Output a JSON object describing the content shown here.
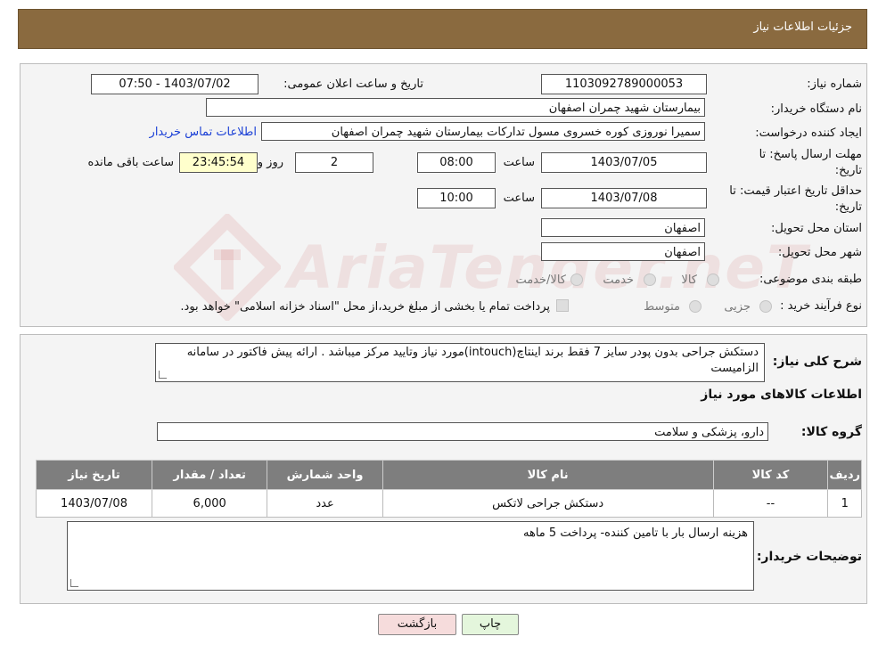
{
  "header": {
    "title": "جزئیات اطلاعات نیاز"
  },
  "form": {
    "need_number_label": "شماره نیاز:",
    "need_number": "1103092789000053",
    "announce_label": "تاریخ و ساعت اعلان عمومی:",
    "announce_value": "1403/07/02 - 07:50",
    "buyer_label": "نام دستگاه خریدار:",
    "buyer_value": "بیمارستان شهید چمران اصفهان",
    "creator_label": "ایجاد کننده درخواست:",
    "creator_value": "سمیرا نوروزی کوره خسروی مسول تدارکات بیمارستان شهید چمران اصفهان",
    "contact_link": "اطلاعات تماس خریدار",
    "reply_deadline_label_1": "مهلت ارسال پاسخ: تا",
    "reply_deadline_label_2": "تاریخ:",
    "reply_date": "1403/07/05",
    "time_label": "ساعت",
    "reply_time": "08:00",
    "days_value": "2",
    "days_label": "روز و",
    "remaining_time": "23:45:54",
    "remaining_label": "ساعت باقی مانده",
    "validity_label_1": "حداقل تاریخ اعتبار قیمت: تا",
    "validity_label_2": "تاریخ:",
    "validity_date": "1403/07/08",
    "validity_time": "10:00",
    "province_label": "استان محل تحویل:",
    "province_value": "اصفهان",
    "city_label": "شهر محل تحویل:",
    "city_value": "اصفهان",
    "category_label": "طبقه بندی موضوعی:",
    "category_options": [
      "کالا",
      "خدمت",
      "کالا/خدمت"
    ],
    "purchase_type_label": "نوع فرآیند خرید :",
    "purchase_options": [
      "جزیی",
      "متوسط"
    ],
    "purchase_note": "پرداخت تمام یا بخشی از مبلغ خرید،از محل \"اسناد خزانه اسلامی\" خواهد بود."
  },
  "details": {
    "summary_label": "شرح کلی نیاز:",
    "summary_text": "دستکش جراحی بدون پودر سایز 7 فقط برند اینتاچ(intouch)مورد نیاز وتایید مرکز میباشد . ارائه پیش فاکتور در سامانه الزامیست",
    "goods_info_title": "اطلاعات کالاهای مورد نیاز",
    "goods_group_label": "گروه کالا:",
    "goods_group_value": "دارو، پزشکی و سلامت",
    "table": {
      "headers": [
        "ردیف",
        "کد کالا",
        "نام کالا",
        "واحد شمارش",
        "تعداد / مقدار",
        "تاریخ نیاز"
      ],
      "rows": [
        [
          "1",
          "--",
          "دستکش جراحی لاتکس",
          "عدد",
          "6,000",
          "1403/07/08"
        ]
      ]
    },
    "buyer_notes_label": "توضیحات خریدار:",
    "buyer_notes_text": "هزینه ارسال بار با تامین کننده- پرداخت 5 ماهه"
  },
  "buttons": {
    "print": "چاپ",
    "back": "بازگشت"
  },
  "watermark": "AriaTender.neT",
  "colors": {
    "header_bg": "#8a6a3f",
    "table_header_bg": "#7e7e7e",
    "remaining_bg": "#ffffcc",
    "back_button_bg": "#f6dcdc",
    "print_button_bg": "#e4f6dc",
    "link": "#1a3fd6"
  }
}
